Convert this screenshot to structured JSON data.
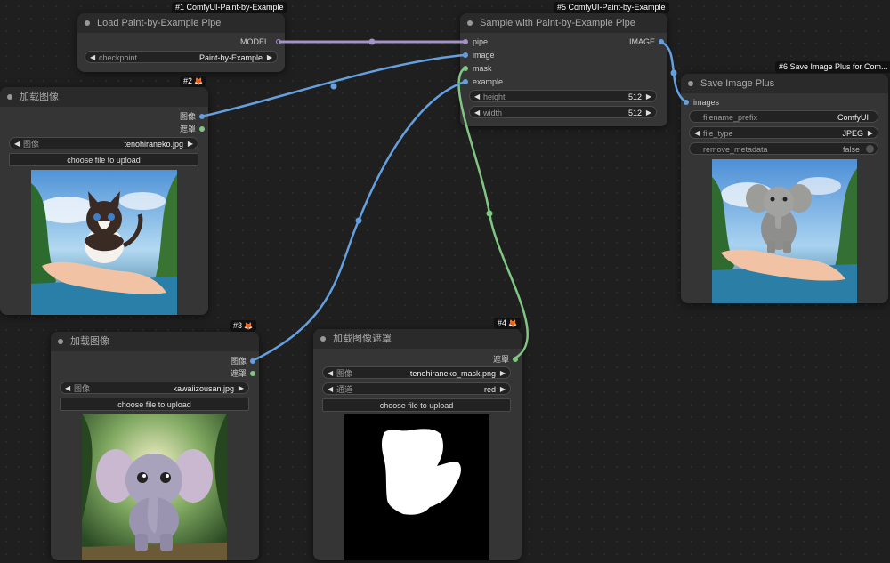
{
  "colors": {
    "pipe_wire": "#a492c9",
    "image_wire": "#64a0e0",
    "mask_wire": "#81c784",
    "canvas": "#1f1f1f",
    "node": "#353535"
  },
  "nodes": {
    "load_pipe": {
      "badge": "#1 ComfyUI-Paint-by-Example",
      "title": "Load Paint-by-Example Pipe",
      "outputs": [
        "MODEL"
      ],
      "widgets": [
        {
          "label": "checkpoint",
          "value": "Paint-by-Example"
        }
      ]
    },
    "sample": {
      "badge": "#5 ComfyUI-Paint-by-Example",
      "title": "Sample with Paint-by-Example Pipe",
      "inputs": [
        "pipe",
        "image",
        "mask",
        "example"
      ],
      "outputs": [
        "IMAGE"
      ],
      "widgets": [
        {
          "label": "height",
          "value": "512"
        },
        {
          "label": "width",
          "value": "512"
        }
      ]
    },
    "save": {
      "badge": "#6 Save Image Plus for Com...",
      "title": "Save Image Plus",
      "inputs": [
        "images"
      ],
      "widgets": [
        {
          "label": "filename_prefix",
          "value": "ComfyUI"
        },
        {
          "label": "file_type",
          "value": "JPEG"
        },
        {
          "label": "remove_metadata",
          "value": "false"
        }
      ],
      "preview": "elephant-on-hand-result"
    },
    "load_image_2": {
      "badge": "#2",
      "title": "加载图像",
      "outputs": [
        "图像",
        "遮罩"
      ],
      "widgets": [
        {
          "label": "图像",
          "value": "tenohiraneko.jpg"
        }
      ],
      "upload_label": "choose file to upload",
      "preview": "kitten-on-hand"
    },
    "load_image_3": {
      "badge": "#3",
      "title": "加载图像",
      "outputs": [
        "图像",
        "遮罩"
      ],
      "widgets": [
        {
          "label": "图像",
          "value": "kawaiizousan.jpg"
        }
      ],
      "upload_label": "choose file to upload",
      "preview": "baby-elephant"
    },
    "load_mask_4": {
      "badge": "#4",
      "title": "加载图像遮罩",
      "outputs": [
        "遮罩"
      ],
      "widgets": [
        {
          "label": "图像",
          "value": "tenohiraneko_mask.png"
        },
        {
          "label": "通道",
          "value": "red"
        }
      ],
      "upload_label": "choose file to upload",
      "preview": "white-cat-mask"
    }
  }
}
